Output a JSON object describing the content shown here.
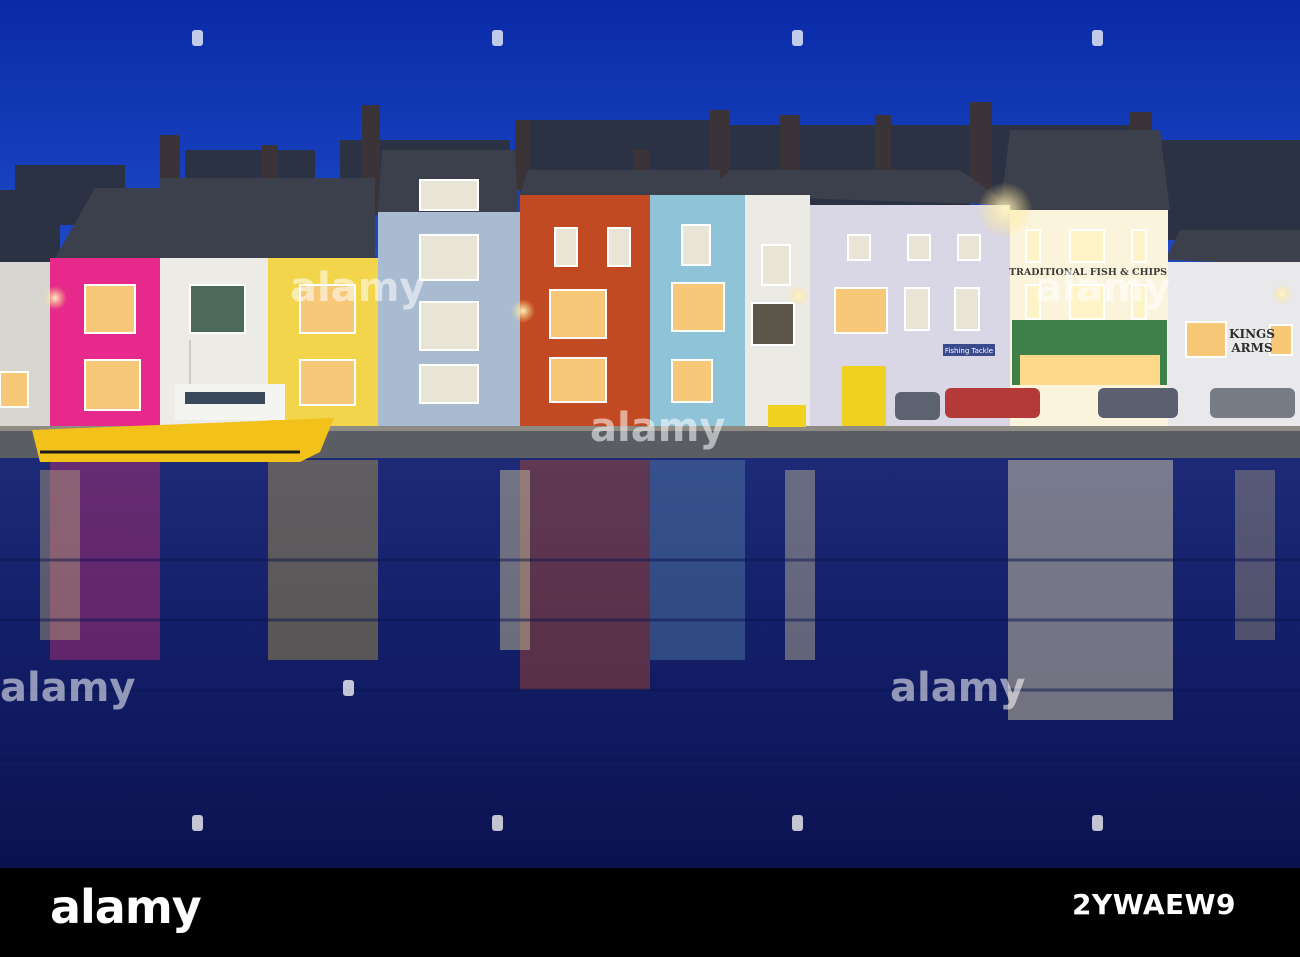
{
  "photo": {
    "signs": {
      "fish_chips": "TRADITIONAL FISH & CHIPS",
      "kings_arms_1": "KINGS",
      "kings_arms_2": "ARMS",
      "shop_sign": "Fishing Tackle"
    },
    "colors": {
      "sky_top": "#0a2fb8",
      "sky_bottom": "#1a4fd8",
      "water_deep": "#0a1660",
      "boat": "#f2c21a"
    }
  },
  "watermark": {
    "text": "alamy"
  },
  "footer": {
    "brand": "alamy",
    "image_id": "2YWAEW9"
  }
}
